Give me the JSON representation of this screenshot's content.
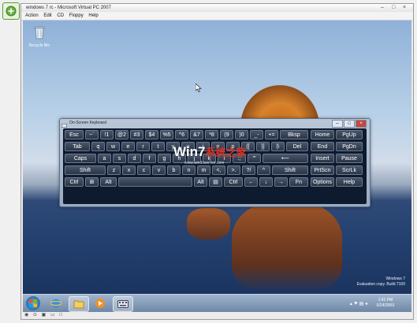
{
  "window": {
    "title": "windows 7 rc - Microsoft Virtual PC 2007",
    "minimize": "–",
    "restore": "□",
    "close": "×"
  },
  "menu": {
    "items": [
      "Action",
      "Edit",
      "CD",
      "Floppy",
      "Help"
    ]
  },
  "desktop": {
    "recycle_bin_label": "Recycle Bin",
    "watermark": {
      "line1": "Windows 7",
      "line2": "Evaluation copy. Build 7100"
    }
  },
  "osk": {
    "title": "On-Screen Keyboard",
    "logo_text": "Win7",
    "logo_red": "系统之家",
    "logo_url": "www.windows7en.com",
    "keys": {
      "row1": [
        "Esc",
        "~`",
        "!1",
        "@2",
        "#3",
        "$4",
        "%5",
        "^6",
        "&7",
        "*8",
        "(9",
        ")0",
        "_-",
        "+=",
        "Bksp",
        "Home",
        "PgUp"
      ],
      "row2": [
        "Tab",
        "q",
        "w",
        "e",
        "r",
        "t",
        "y",
        "u",
        "i",
        "o",
        "p",
        "{[",
        "}]",
        "|\\",
        "Del",
        "End",
        "PgDn"
      ],
      "row3": [
        "Caps",
        "a",
        "s",
        "d",
        "f",
        "g",
        "h",
        "j",
        "k",
        "l",
        ":;",
        "\"'",
        "⟵",
        "Insert",
        "Pause"
      ],
      "row4": [
        "Shift",
        "z",
        "x",
        "c",
        "v",
        "b",
        "n",
        "m",
        "<,",
        ">.",
        "?/",
        "^",
        "Shift",
        "PrtScn",
        "ScrLk"
      ],
      "row5": [
        "Ctrl",
        "⊞",
        "Alt",
        "",
        "Alt",
        "▤",
        "Ctrl",
        "←",
        "↓",
        "→",
        "Fn",
        "Options",
        "Help"
      ]
    }
  },
  "taskbar": {
    "clock_time": "1:41 PM",
    "clock_date": "6/24/2009"
  },
  "statusbar": {
    "items": [
      "◉",
      "⊙",
      "▣",
      "▭",
      "□"
    ]
  }
}
